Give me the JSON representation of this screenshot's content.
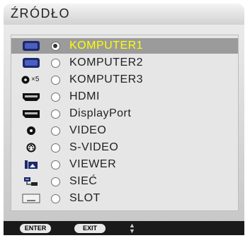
{
  "menu": {
    "title": "ŹRÓDŁO",
    "selected_index": 0,
    "items": [
      {
        "label": "KOMPUTER1",
        "icon": "computer-port-icon",
        "selected": true
      },
      {
        "label": "KOMPUTER2",
        "icon": "computer-port-icon",
        "selected": false
      },
      {
        "label": "KOMPUTER3",
        "icon": "bnc-x5-icon",
        "icon_text": "×5",
        "selected": false
      },
      {
        "label": "HDMI",
        "icon": "hdmi-port-icon",
        "selected": false
      },
      {
        "label": "DisplayPort",
        "icon": "displayport-icon",
        "selected": false
      },
      {
        "label": "VIDEO",
        "icon": "rca-video-icon",
        "selected": false
      },
      {
        "label": "S-VIDEO",
        "icon": "s-video-icon",
        "selected": false
      },
      {
        "label": "VIEWER",
        "icon": "viewer-icon",
        "selected": false
      },
      {
        "label": "SIEĆ",
        "icon": "network-icon",
        "selected": false
      },
      {
        "label": "SLOT",
        "icon": "slot-icon",
        "selected": false
      }
    ]
  },
  "footer": {
    "enter_label": "ENTER",
    "exit_label": "EXIT",
    "nav_hint": "up-down-arrows-icon"
  },
  "colors": {
    "selected_text": "#ffff00",
    "selected_bg": "#9b9b9b",
    "footer_bg": "#1a1a1a"
  }
}
